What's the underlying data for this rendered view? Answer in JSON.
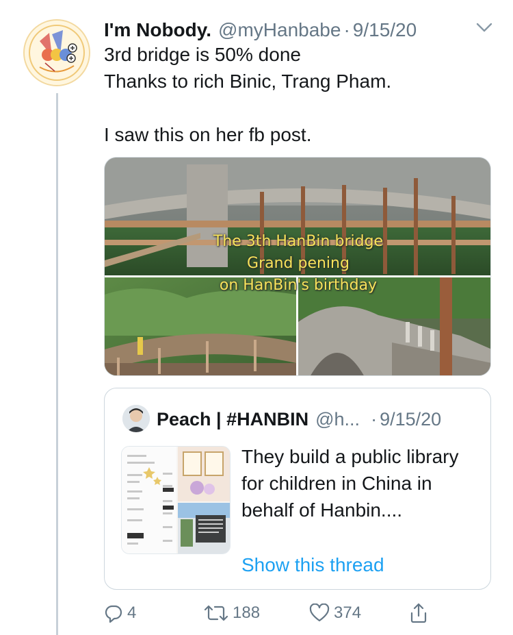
{
  "tweet": {
    "display_name": "I'm Nobody.",
    "handle": "@myHanbabe",
    "separator": "·",
    "date": "9/15/20",
    "text_lines": [
      "3rd bridge is 50% done",
      "Thanks to rich Binic, Trang Pham.",
      "",
      "I saw this on her fb post."
    ],
    "media_caption": {
      "line1": "The 3th HanBin bridge",
      "line2": "Grand pening",
      "line3": "on HanBin's birthday"
    }
  },
  "quote": {
    "display_name": "Peach | #HANBIN",
    "handle": "@h...",
    "separator": "·",
    "date": "9/15/20",
    "text": "They build a public library for children in China in behalf of Hanbin....",
    "link": "Show this thread"
  },
  "actions": {
    "reply_count": "4",
    "retweet_count": "188",
    "like_count": "374"
  },
  "colors": {
    "text_primary": "#14171a",
    "text_secondary": "#657786",
    "link": "#1da1f2",
    "thread_line": "#c7d0d8"
  },
  "icons": {
    "menu": "chevron-down-icon",
    "reply": "reply-icon",
    "retweet": "retweet-icon",
    "like": "heart-icon",
    "share": "share-icon"
  }
}
